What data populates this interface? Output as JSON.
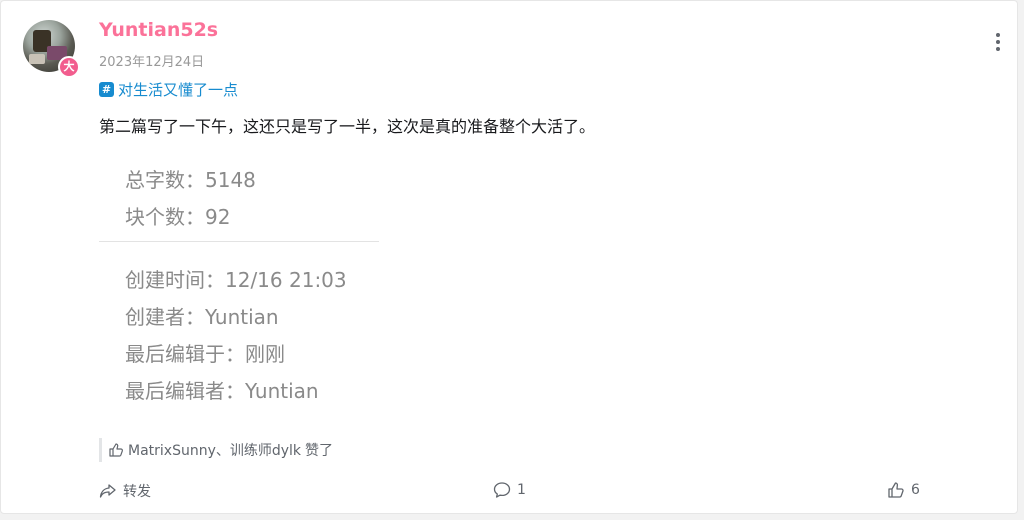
{
  "post": {
    "username": "Yuntian52s",
    "date": "2023年12月24日",
    "avatar_badge": "大",
    "topic": "对生活又懂了一点",
    "text": "第二篇写了一下午，这还只是写了一半，这次是真的准备整个大活了。"
  },
  "embed": {
    "line1": "总字数：5148",
    "line2": "块个数：92",
    "line3": "创建时间：12/16 21:03",
    "line4": "创建者：Yuntian",
    "line5": "最后编辑于：刚刚",
    "line6": "最后编辑者：Yuntian"
  },
  "likes": {
    "names": "MatrixSunny、训练师dylk",
    "suffix": "赞了"
  },
  "actions": {
    "forward_label": "转发",
    "comment_count": "1",
    "like_count": "6"
  },
  "colors": {
    "username": "#fb7299",
    "topic": "#178bcf",
    "muted": "#999999"
  }
}
